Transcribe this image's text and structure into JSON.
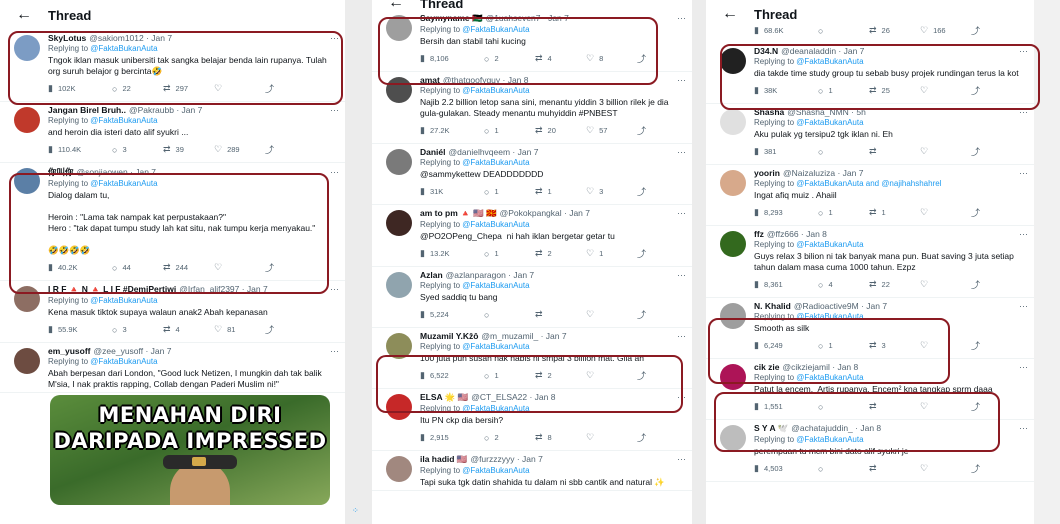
{
  "thread_title": "Thread",
  "col1": {
    "tweets": [
      {
        "name": "SkyLotus",
        "handle": "@sakiom1012 · Jan 7",
        "reply_prefix": "Replying to ",
        "reply_to": "@FaktaBukanAuta",
        "text": "Tngok iklan masuk unibersiti tak sangka belajar benda lain rupanya. Tulah org suruh belajor g bercinta🤣",
        "replies": "102K",
        "retweets": "22",
        "likes": "297",
        "avatar_color": "#7c9cc4"
      },
      {
        "name": "Jangan Birel Bruh..",
        "handle": "@Pakraubb · Jan 7",
        "reply_prefix": "Replying to ",
        "reply_to": "@FaktaBukanAuta",
        "text": "and heroin dia isteri dato alif syukri ...",
        "replies": "110.4K",
        "retweets": "3",
        "likes": "39",
        "extra": "289",
        "avatar_color": "#c0392b"
      },
      {
        "name": "你叫你",
        "handle": "@sonjiaowen · Jan 7",
        "reply_prefix": "Replying to ",
        "reply_to": "@FaktaBukanAuta",
        "text": "Dialog dalam tu,\n\nHeroin : \"Lama tak nampak kat perpustakaan?\"\nHero : \"tak dapat tumpu study lah kat situ, nak tumpu kerja menyakau.\"\n\n🤣🤣🤣🤣",
        "replies": "40.2K",
        "retweets": "44",
        "likes": "244",
        "avatar_color": "#5b7fa6"
      },
      {
        "name": "I R F 🔺 N 🔺 L I F #DemiPertiwi",
        "handle": "@Irfan_alif2397 · Jan 7",
        "reply_prefix": "Replying to ",
        "reply_to": "@FaktaBukanAuta",
        "text": "Kena masuk tiktok supaya walaun anak2 Abah kepanasan",
        "replies": "55.9K",
        "retweets": "3",
        "likes": "4",
        "extra": "81",
        "avatar_color": "#8d6e63"
      },
      {
        "name": "em_yusoff",
        "handle": "@zee_yusoff · Jan 7",
        "reply_prefix": "Replying to ",
        "reply_to": "@FaktaBukanAuta",
        "text": "Abah berpesan dari London, \"Good luck Netizen, I mungkin dah tak balik M'sia, I nak praktis rapping, Collab dengan Paderi Muslim ni!\"",
        "avatar_color": "#6d4c41"
      }
    ],
    "meme_line1": "MENAHAN DIRI",
    "meme_line2": "DARIPADA IMPRESSED"
  },
  "col2": {
    "tweets": [
      {
        "name": "Saymyname 🇵🇸",
        "handle": "@1uahseven7 · Jan 7",
        "reply_prefix": "Replying to ",
        "reply_to": "@FaktaBukanAuta",
        "text": "Bersih dan stabil tahi kucing",
        "replies": "8,106",
        "retweets": "2",
        "likes": "4",
        "extra": "8",
        "avatar_color": "#9e9e9e"
      },
      {
        "name": "amat",
        "handle": "@thatgoofyguy · Jan 8",
        "reply_prefix": "Replying to ",
        "reply_to": "@FaktaBukanAuta",
        "text": "Najib 2.2 billion letop sana sini, menantu yiddin 3 billion rilek je dia gula-gulakan. Steady menantu muhyiddin #PNBEST",
        "replies": "27.2K",
        "retweets": "1",
        "likes": "20",
        "extra": "57",
        "avatar_color": "#4e4e4e"
      },
      {
        "name": "Daniél",
        "handle": "@danielhvqeem · Jan 7",
        "reply_prefix": "Replying to ",
        "reply_to": "@FaktaBukanAuta",
        "text": "@sammykettew DEADDDDDDD",
        "replies": "31K",
        "retweets": "1",
        "likes": "1",
        "extra": "3",
        "avatar_color": "#7a7a7a"
      },
      {
        "name": "am to pm 🔺 🇺🇸 🇲🇰",
        "handle": "@Pokokpangkal · Jan 7",
        "reply_prefix": "Replying to ",
        "reply_to": "@FaktaBukanAuta",
        "text": "@PO2OPeng_Chepa  ni hah iklan bergetar getar tu",
        "replies": "13.2K",
        "retweets": "1",
        "likes": "2",
        "extra": "1",
        "avatar_color": "#3e2723"
      },
      {
        "name": "Azlan",
        "handle": "@azlanparagon · Jan 7",
        "reply_prefix": "Replying to ",
        "reply_to": "@FaktaBukanAuta",
        "text": "Syed saddiq tu bang",
        "replies": "5,224",
        "retweets": "",
        "likes": "",
        "extra": "",
        "avatar_color": "#90a4ae"
      },
      {
        "name": "Muzamil Y.Kẑô",
        "handle": "@m_muzamil_ · Jan 7",
        "reply_prefix": "Replying to ",
        "reply_to": "@FaktaBukanAuta",
        "text": "100 juta pun susah nak habis ni smpai 3 billion mat. Gila ah",
        "replies": "6,522",
        "retweets": "1",
        "likes": "2",
        "avatar_color": "#8d8d5a"
      },
      {
        "name": "ELSA 🌟 🇺🇸",
        "handle": "@CT_ELSA22 · Jan 8",
        "reply_prefix": "Replying to ",
        "reply_to": "@FaktaBukanAuta",
        "text": "Itu PN ckp dia bersih?",
        "replies": "2,915",
        "retweets": "2",
        "likes": "8",
        "avatar_color": "#c62828"
      },
      {
        "name": "ila hadid 🇺🇸",
        "handle": "@furzzzyyy · Jan 7",
        "reply_prefix": "Replying to ",
        "reply_to": "@FaktaBukanAuta",
        "text": "Tapi suka tgk datin shahida tu dalam ni sbb cantik and natural ✨",
        "avatar_color": "#a1887f"
      }
    ]
  },
  "col3": {
    "top_stats": {
      "replies": "68.6K",
      "retweets": "26",
      "likes": "166"
    },
    "tweets": [
      {
        "name": "D34.N",
        "handle": "@deanaladdin · Jan 7",
        "reply_prefix": "Replying to ",
        "reply_to": "@FaktaBukanAuta",
        "text": "dia takde time study group tu sebab busy projek rundingan terus la kot",
        "replies": "38K",
        "retweets": "1",
        "likes": "25",
        "avatar_color": "#212121"
      },
      {
        "name": "Shasha",
        "handle": "@Shasha_NMN · 5h",
        "reply_prefix": "Replying to ",
        "reply_to": "@FaktaBukanAuta",
        "text": "Aku pulak yg tersipu2 tgk iklan ni. Eh",
        "replies": "381",
        "retweets": "",
        "likes": "",
        "avatar_color": "#e0e0e0"
      },
      {
        "name": "yoorin",
        "handle": "@Naizaluziza · Jan 7",
        "reply_prefix": "Replying to ",
        "reply_to": "@FaktaBukanAuta and @najihahshahrel",
        "text": "Ingat afiq muiz . Ahaiil",
        "replies": "8,293",
        "retweets": "1",
        "likes": "1",
        "avatar_color": "#d7a98b"
      },
      {
        "name": "ffz",
        "handle": "@ffz666 · Jan 8",
        "reply_prefix": "Replying to ",
        "reply_to": "@FaktaBukanAuta",
        "text": "Guys relax 3 bilion ni tak banyak mana pun. Buat saving 3 juta setiap tahun dalam masa cuma 1000 tahun. Ezpz",
        "replies": "8,361",
        "retweets": "4",
        "likes": "22",
        "avatar_color": "#33691e"
      },
      {
        "name": "N. Khalid",
        "handle": "@Radioactive9M · Jan 7",
        "reply_prefix": "Replying to ",
        "reply_to": "@FaktaBukanAuta",
        "text": "Smooth as silk",
        "replies": "6,249",
        "retweets": "1",
        "likes": "3",
        "avatar_color": "#9e9e9e"
      },
      {
        "name": "cik zie",
        "handle": "@cikziejamil · Jan 8",
        "reply_prefix": "Replying to ",
        "reply_to": "@FaktaBukanAuta",
        "text": "Patut la encem.  Artis rupanya. Encem² kna tangkap sprm daaa",
        "replies": "1,551",
        "retweets": "",
        "likes": "",
        "avatar_color": "#ad1457"
      },
      {
        "name": "S Y A 🕊️",
        "handle": "@achatajuddin_ · Jan 8",
        "reply_prefix": "Replying to ",
        "reply_to": "@FaktaBukanAuta",
        "text": "perempuan tu mcm bini dato alif syukri je",
        "replies": "4,503",
        "retweets": "",
        "likes": "",
        "avatar_color": "#bdbdbd"
      }
    ]
  },
  "icons": {
    "back": "←",
    "more": "···",
    "reply": "○",
    "retweet": "⇄",
    "like": "♡",
    "share": "⤴",
    "views": "📊"
  },
  "accent": "#1d9bf0",
  "circle_color": "#8b1a22"
}
